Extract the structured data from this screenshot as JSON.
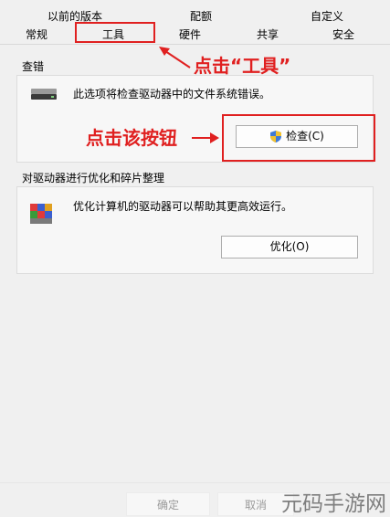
{
  "tabs_top": [
    "以前的版本",
    "配额",
    "自定义"
  ],
  "tabs_bottom": [
    "常规",
    "工具",
    "硬件",
    "共享",
    "安全"
  ],
  "error_checking": {
    "title": "查错",
    "description": "此选项将检查驱动器中的文件系统错误。",
    "button_label": "检查(C)"
  },
  "optimize": {
    "title": "对驱动器进行优化和碎片整理",
    "description": "优化计算机的驱动器可以帮助其更高效运行。",
    "button_label": "优化(O)"
  },
  "annotations": {
    "tab_hint": "点击“工具”",
    "button_hint": "点击该按钮"
  },
  "footer": {
    "ok_label": "确定",
    "cancel_label": "取消"
  },
  "watermark": "元码手游网",
  "colors": {
    "annotation_red": "#e02020",
    "window_bg": "#f0f0f0"
  }
}
